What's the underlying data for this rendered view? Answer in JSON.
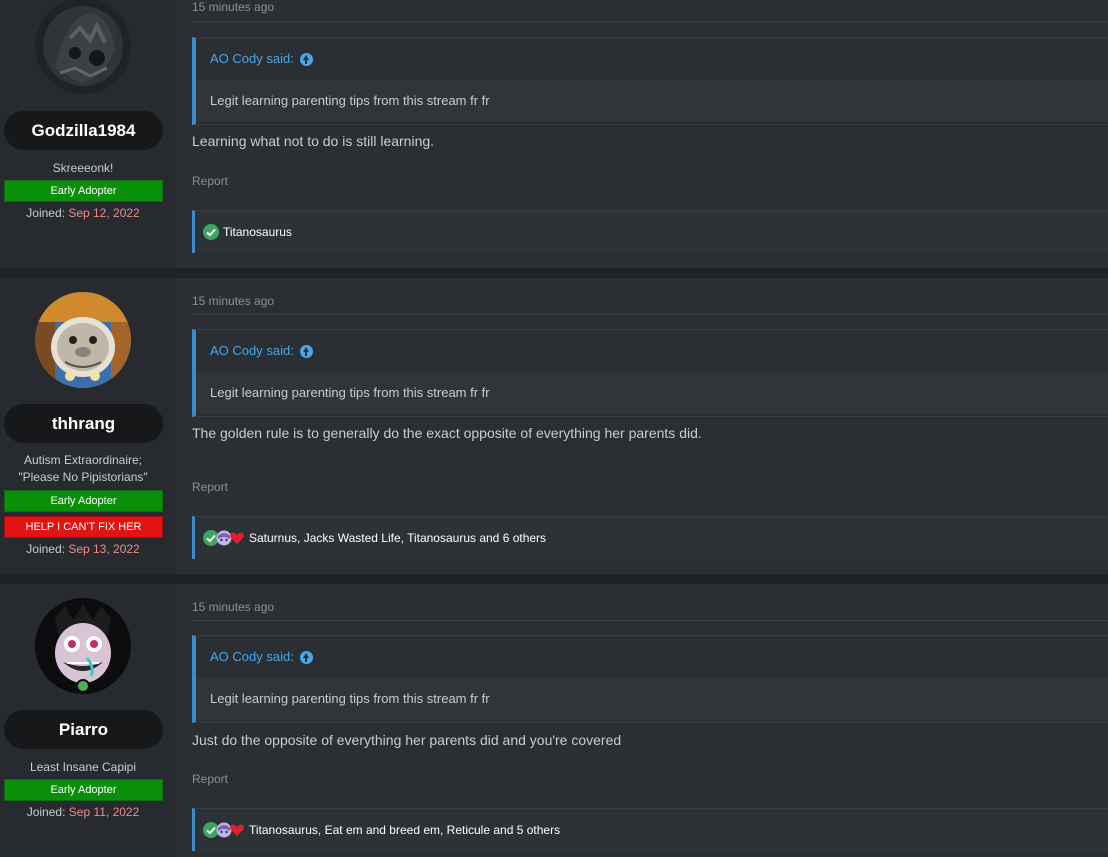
{
  "posts": [
    {
      "user": {
        "name": "Godzilla1984",
        "title_lines": [
          "Skreeeonk!"
        ],
        "banners": [
          {
            "label": "Early Adopter",
            "color": "#0a8f0a"
          }
        ],
        "joined_label": "Joined:",
        "joined_date": "Sep 12, 2022",
        "avatar_icon": "godzilla-avatar"
      },
      "time": "15 minutes ago",
      "quote": {
        "author": "AO Cody said:",
        "text": "Legit learning parenting tips from this stream fr fr"
      },
      "message": "Learning what not to do is still learning.",
      "report": "Report",
      "reactions": {
        "icons": [
          "check-icon"
        ],
        "text": "Titanosaurus"
      }
    },
    {
      "user": {
        "name": "thhrang",
        "title_lines": [
          "Autism Extraordinaire;",
          "\"Please No Pipistorians\""
        ],
        "banners": [
          {
            "label": "Early Adopter",
            "color": "#0a8f0a"
          },
          {
            "label": "HELP I CAN'T FIX HER",
            "color": "#e21313"
          }
        ],
        "joined_label": "Joined:",
        "joined_date": "Sep 13, 2022",
        "avatar_icon": "opossum-avatar"
      },
      "time": "15 minutes ago",
      "quote": {
        "author": "AO Cody said:",
        "text": "Legit learning parenting tips from this stream fr fr"
      },
      "message": "The golden rule is to generally do the exact opposite of everything her parents did.",
      "report": "Report",
      "reactions": {
        "icons": [
          "check-icon",
          "anime-face-icon",
          "heart-icon"
        ],
        "text": "Saturnus, Jacks Wasted Life, Titanosaurus and 6 others"
      }
    },
    {
      "user": {
        "name": "Piarro",
        "title_lines": [
          "Least Insane Capipi"
        ],
        "banners": [
          {
            "label": "Early Adopter",
            "color": "#0a8f0a"
          }
        ],
        "joined_label": "Joined:",
        "joined_date": "Sep 11, 2022",
        "avatar_icon": "clown-avatar"
      },
      "time": "15 minutes ago",
      "quote": {
        "author": "AO Cody said:",
        "text": "Legit learning parenting tips from this stream fr fr"
      },
      "message": "Just do the opposite of everything her parents did and you're covered",
      "report": "Report",
      "reactions": {
        "icons": [
          "check-icon",
          "anime-face-icon",
          "heart-icon"
        ],
        "text": "Titanosaurus, Eat em and breed em, Reticule and 5 others"
      }
    }
  ]
}
